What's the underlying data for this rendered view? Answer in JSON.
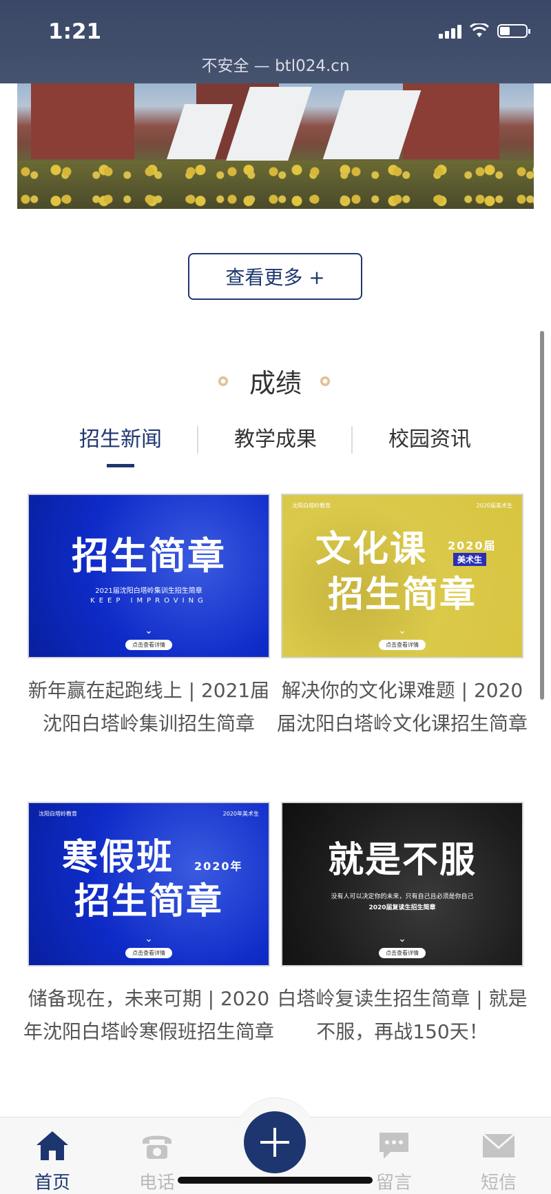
{
  "status_bar": {
    "time": "1:21",
    "url": "不安全 — btl024.cn"
  },
  "more_button": {
    "label": "查看更多 +"
  },
  "section": {
    "title": "成绩"
  },
  "tabs": [
    {
      "label": "招生新闻",
      "active": true
    },
    {
      "label": "教学成果",
      "active": false
    },
    {
      "label": "校园资讯",
      "active": false
    }
  ],
  "cards": [
    {
      "poster": {
        "title": "招生简章",
        "line1": "2021届沈阳白塔岭集训生招生简章",
        "line2": "KEEP IMPROVING",
        "pill": "点击查看详情"
      },
      "caption": "新年赢在起跑线上 | 2021届沈阳白塔岭集训招生简章"
    },
    {
      "poster": {
        "title_line1": "文化课",
        "title_line2": "招生简章",
        "year": "2020届",
        "badge": "美术生",
        "brand": "沈阳白塔岭教育",
        "brand_right": "2020届美术生",
        "pill": "点击查看详情"
      },
      "caption": "解决你的文化课难题 | 2020届沈阳白塔岭文化课招生简章"
    },
    {
      "poster": {
        "title_line1": "寒假班",
        "title_line2": "招生简章",
        "year": "2020年",
        "brand": "沈阳白塔岭教育",
        "brand_right": "2020年美术生",
        "pill": "点击查看详情"
      },
      "caption": "储备现在，未来可期 | 2020年沈阳白塔岭寒假班招生简章"
    },
    {
      "poster": {
        "title": "就是不服",
        "line1": "没有人可以决定你的未来，只有自己且必须是你自己",
        "line2": "2020届复读生招生简章",
        "pill": "点击查看详情"
      },
      "caption": "白塔岭复读生招生简章 | 就是不服，再战150天！"
    }
  ],
  "bottom_nav": [
    {
      "label": "首页",
      "icon": "home-icon",
      "active": true
    },
    {
      "label": "电话",
      "icon": "phone-icon",
      "active": false
    },
    {
      "label": "",
      "icon": "plus-icon",
      "active": false
    },
    {
      "label": "留言",
      "icon": "message-icon",
      "active": false
    },
    {
      "label": "短信",
      "icon": "mail-icon",
      "active": false
    }
  ],
  "colors": {
    "brand": "#1d3670",
    "inactive": "#b9b9b9"
  }
}
